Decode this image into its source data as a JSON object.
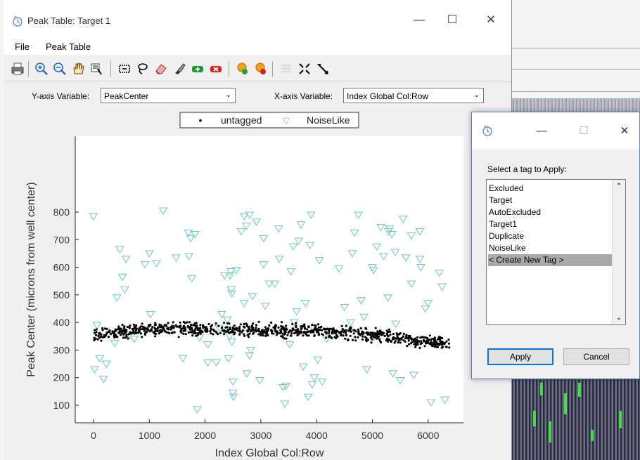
{
  "window": {
    "title": "Peak Table: Target 1",
    "controls": [
      "—",
      "☐",
      "✕"
    ]
  },
  "menu": [
    "File",
    "Peak Table"
  ],
  "toolbar_icons": [
    "print-icon",
    "zoom-in-icon",
    "zoom-out-icon",
    "pan-hand-icon",
    "data-cursor-icon",
    "select-box-icon",
    "lasso-icon",
    "eraser-icon",
    "brush-icon",
    "add-tag-icon",
    "remove-tag-icon",
    "tag-yellow-icon",
    "tag-red-icon",
    "grid-icon",
    "fit-icon",
    "arrow-icon"
  ],
  "axis_controls": {
    "y_label": "Y-axis Variable:",
    "y_value": "PeakCenter",
    "x_label": "X-axis Variable:",
    "x_value": "Index Global Col:Row"
  },
  "legend": [
    {
      "symbol": "•",
      "label": "untagged"
    },
    {
      "symbol": "▽",
      "label": "NoiseLike"
    }
  ],
  "colors": {
    "untagged": "#000000",
    "noiselike": "#7ec8c8"
  },
  "chart_data": {
    "type": "scatter",
    "xlabel": "Index Global Col:Row",
    "ylabel": "Peak Center (microns from well center)",
    "xlim": [
      -300,
      6700
    ],
    "ylim": [
      50,
      830
    ],
    "x_ticks": [
      0,
      1000,
      2000,
      3000,
      4000,
      5000,
      6000
    ],
    "y_ticks": [
      100,
      200,
      300,
      400,
      500,
      600,
      700,
      800
    ],
    "series": [
      {
        "name": "untagged",
        "marker": "dot",
        "trend": [
          [
            0,
            355
          ],
          [
            500,
            365
          ],
          [
            1000,
            375
          ],
          [
            2000,
            375
          ],
          [
            3000,
            372
          ],
          [
            4000,
            370
          ],
          [
            5000,
            355
          ],
          [
            6000,
            330
          ],
          [
            6400,
            320
          ]
        ],
        "spread": 20,
        "count": 900,
        "range": [
          0,
          6400
        ]
      },
      {
        "name": "NoiseLike",
        "marker": "triangle-down",
        "points": [
          [
            0,
            785
          ],
          [
            20,
            230
          ],
          [
            60,
            390
          ],
          [
            110,
            270
          ],
          [
            180,
            195
          ],
          [
            230,
            250
          ],
          [
            380,
            325
          ],
          [
            420,
            490
          ],
          [
            470,
            665
          ],
          [
            520,
            565
          ],
          [
            560,
            520
          ],
          [
            580,
            630
          ],
          [
            650,
            355
          ],
          [
            730,
            340
          ],
          [
            920,
            610
          ],
          [
            1000,
            650
          ],
          [
            1020,
            430
          ],
          [
            1130,
            615
          ],
          [
            1250,
            805
          ],
          [
            1480,
            635
          ],
          [
            1600,
            270
          ],
          [
            1700,
            725
          ],
          [
            1710,
            640
          ],
          [
            1740,
            705
          ],
          [
            1760,
            560
          ],
          [
            1820,
            720
          ],
          [
            1860,
            85
          ],
          [
            1900,
            345
          ],
          [
            2050,
            320
          ],
          [
            2050,
            255
          ],
          [
            2200,
            255
          ],
          [
            2250,
            380
          ],
          [
            2300,
            430
          ],
          [
            2350,
            570
          ],
          [
            2400,
            410
          ],
          [
            2420,
            270
          ],
          [
            2440,
            350
          ],
          [
            2450,
            570
          ],
          [
            2460,
            585
          ],
          [
            2470,
            520
          ],
          [
            2480,
            505
          ],
          [
            2480,
            330
          ],
          [
            2500,
            145
          ],
          [
            2500,
            185
          ],
          [
            2510,
            130
          ],
          [
            2560,
            590
          ],
          [
            2650,
            730
          ],
          [
            2700,
            785
          ],
          [
            2700,
            470
          ],
          [
            2740,
            750
          ],
          [
            2750,
            215
          ],
          [
            2800,
            790
          ],
          [
            2800,
            280
          ],
          [
            2820,
            300
          ],
          [
            2850,
            495
          ],
          [
            2920,
            765
          ],
          [
            2980,
            190
          ],
          [
            3050,
            705
          ],
          [
            3050,
            610
          ],
          [
            3080,
            460
          ],
          [
            3150,
            540
          ],
          [
            3250,
            540
          ],
          [
            3320,
            740
          ],
          [
            3330,
            630
          ],
          [
            3400,
            165
          ],
          [
            3430,
            105
          ],
          [
            3450,
            170
          ],
          [
            3520,
            320
          ],
          [
            3540,
            585
          ],
          [
            3580,
            675
          ],
          [
            3600,
            400
          ],
          [
            3640,
            440
          ],
          [
            3680,
            695
          ],
          [
            3720,
            755
          ],
          [
            3760,
            240
          ],
          [
            3800,
            470
          ],
          [
            3850,
            130
          ],
          [
            3880,
            680
          ],
          [
            3900,
            790
          ],
          [
            3920,
            175
          ],
          [
            3930,
            380
          ],
          [
            3960,
            200
          ],
          [
            4020,
            265
          ],
          [
            4050,
            625
          ],
          [
            4100,
            185
          ],
          [
            4180,
            340
          ],
          [
            4400,
            595
          ],
          [
            4500,
            455
          ],
          [
            4610,
            400
          ],
          [
            4640,
            650
          ],
          [
            4680,
            725
          ],
          [
            4750,
            790
          ],
          [
            4800,
            480
          ],
          [
            4850,
            420
          ],
          [
            4900,
            230
          ],
          [
            5000,
            600
          ],
          [
            5020,
            590
          ],
          [
            5030,
            350
          ],
          [
            5080,
            675
          ],
          [
            5150,
            745
          ],
          [
            5200,
            640
          ],
          [
            5280,
            490
          ],
          [
            5290,
            730
          ],
          [
            5310,
            740
          ],
          [
            5350,
            720
          ],
          [
            5370,
            215
          ],
          [
            5410,
            655
          ],
          [
            5420,
            395
          ],
          [
            5500,
            190
          ],
          [
            5550,
            775
          ],
          [
            5600,
            635
          ],
          [
            5700,
            540
          ],
          [
            5700,
            715
          ],
          [
            5740,
            210
          ],
          [
            5850,
            730
          ],
          [
            5850,
            630
          ],
          [
            5870,
            600
          ],
          [
            5950,
            450
          ],
          [
            6000,
            470
          ],
          [
            6050,
            110
          ],
          [
            6200,
            580
          ],
          [
            6250,
            530
          ],
          [
            6300,
            120
          ]
        ]
      }
    ]
  },
  "dialog": {
    "controls": [
      "—",
      "☐",
      "✕"
    ],
    "prompt": "Select a tag to Apply:",
    "tags": [
      "Excluded",
      "Target",
      "AutoExcluded",
      "Target1",
      "Duplicate",
      "NoiseLike",
      "< Create New Tag >"
    ],
    "selected_index": 6,
    "apply_label": "Apply",
    "cancel_label": "Cancel"
  }
}
